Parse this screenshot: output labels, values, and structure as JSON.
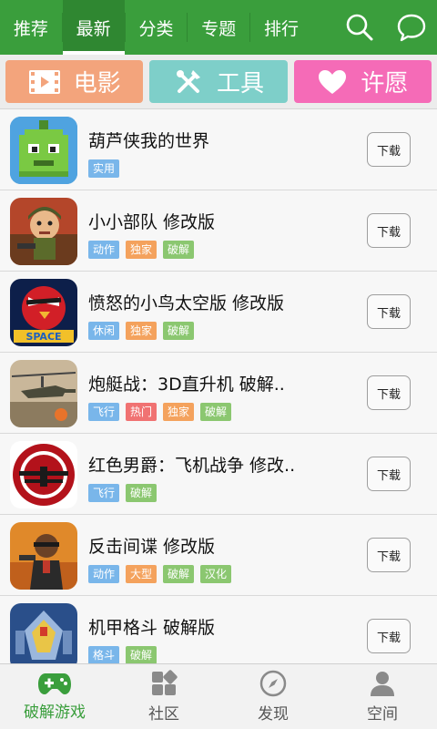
{
  "colors": {
    "brand_green": "#3a9e3c",
    "movie": "#f3a47c",
    "tools": "#7ecfc9",
    "wish": "#f56bb7",
    "tag_blue": "#79b6ea",
    "tag_orange": "#f4a25d",
    "tag_green": "#8bc770",
    "tag_red": "#f07272"
  },
  "nav": {
    "tabs": [
      "推荐",
      "最新",
      "分类",
      "专题",
      "排行"
    ],
    "active_tab": "最新",
    "icons": [
      "search-icon",
      "chat-bubble-icon"
    ]
  },
  "categories": [
    {
      "label": "电影",
      "icon": "film-icon"
    },
    {
      "label": "工具",
      "icon": "tools-icon"
    },
    {
      "label": "许愿",
      "icon": "heart-icon"
    }
  ],
  "download_label": "下载",
  "apps": [
    {
      "title": "葫芦侠我的世界",
      "tags": [
        {
          "t": "实用",
          "c": "tag_blue"
        }
      ],
      "icon": "pixel-creature-icon"
    },
    {
      "title": "小小部队  修改版",
      "tags": [
        {
          "t": "动作",
          "c": "tag_blue"
        },
        {
          "t": "独家",
          "c": "tag_orange"
        },
        {
          "t": "破解",
          "c": "tag_green"
        }
      ],
      "icon": "soldier-icon"
    },
    {
      "title": "愤怒的小鸟太空版  修改版",
      "tags": [
        {
          "t": "休闲",
          "c": "tag_blue"
        },
        {
          "t": "独家",
          "c": "tag_orange"
        },
        {
          "t": "破解",
          "c": "tag_green"
        }
      ],
      "icon": "angry-bird-space-icon"
    },
    {
      "title": "炮艇战：3D直升机  破解..",
      "tags": [
        {
          "t": "飞行",
          "c": "tag_blue"
        },
        {
          "t": "热门",
          "c": "tag_red"
        },
        {
          "t": "独家",
          "c": "tag_orange"
        },
        {
          "t": "破解",
          "c": "tag_green"
        }
      ],
      "icon": "helicopter-icon"
    },
    {
      "title": "红色男爵：飞机战争  修改..",
      "tags": [
        {
          "t": "飞行",
          "c": "tag_blue"
        },
        {
          "t": "破解",
          "c": "tag_green"
        }
      ],
      "icon": "red-baron-icon"
    },
    {
      "title": "反击间谍    修改版",
      "tags": [
        {
          "t": "动作",
          "c": "tag_blue"
        },
        {
          "t": "大型",
          "c": "tag_orange"
        },
        {
          "t": "破解",
          "c": "tag_green"
        },
        {
          "t": "汉化",
          "c": "tag_green"
        }
      ],
      "icon": "spy-icon"
    },
    {
      "title": "机甲格斗  破解版",
      "tags": [
        {
          "t": "格斗",
          "c": "tag_blue"
        },
        {
          "t": "破解",
          "c": "tag_green"
        }
      ],
      "icon": "mech-icon"
    }
  ],
  "bottom": {
    "items": [
      {
        "label": "破解游戏",
        "icon": "gamepad-icon"
      },
      {
        "label": "社区",
        "icon": "grid-icon"
      },
      {
        "label": "发现",
        "icon": "compass-icon"
      },
      {
        "label": "空间",
        "icon": "person-icon"
      }
    ],
    "active": "破解游戏"
  }
}
